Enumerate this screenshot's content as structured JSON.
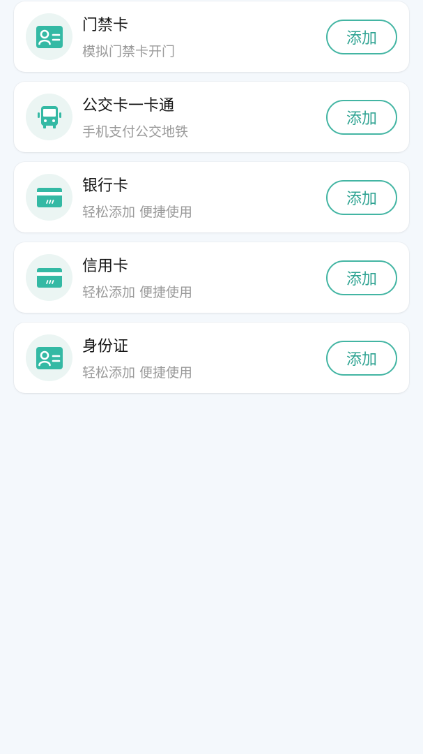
{
  "accent_color": "#2fa392",
  "icon_color": "#34b9a4",
  "cards": [
    {
      "icon": "id-card-icon",
      "title": "门禁卡",
      "subtitle": "模拟门禁卡开门",
      "button": "添加"
    },
    {
      "icon": "bus-icon",
      "title": "公交卡一卡通",
      "subtitle": "手机支付公交地铁",
      "button": "添加"
    },
    {
      "icon": "bank-card-icon",
      "title": "银行卡",
      "subtitle": "轻松添加 便捷使用",
      "button": "添加"
    },
    {
      "icon": "credit-card-icon",
      "title": "信用卡",
      "subtitle": "轻松添加 便捷使用",
      "button": "添加"
    },
    {
      "icon": "id-card-icon",
      "title": "身份证",
      "subtitle": "轻松添加 便捷使用",
      "button": "添加"
    }
  ]
}
